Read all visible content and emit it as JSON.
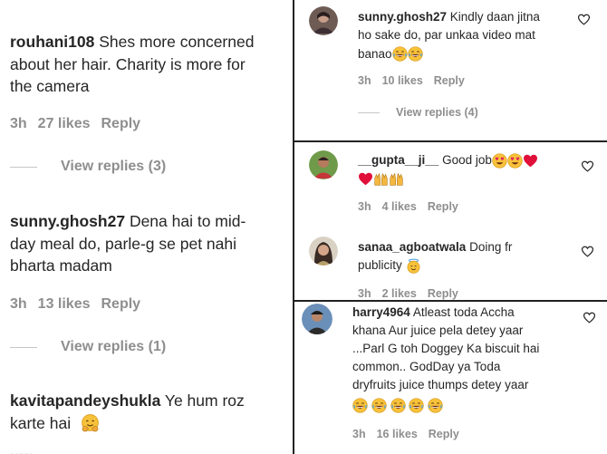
{
  "left": {
    "c1": {
      "user": "rouhani108",
      "text1": "Shes more concerned",
      "text2": "about her hair. Charity is more for",
      "text3": "the camera",
      "time": "3h",
      "likes": "27 likes",
      "reply": "Reply",
      "view": "View replies (3)"
    },
    "c2": {
      "user": "sunny.ghosh27",
      "text1": "Dena hai to mid-",
      "text2": "day meal do, parle-g se pet nahi",
      "text3": "bharta madam",
      "time": "3h",
      "likes": "13 likes",
      "reply": "Reply",
      "view": "View replies (1)"
    },
    "c3": {
      "user": "kavitapandeyshukla",
      "text1": "Ye hum roz",
      "text2": "karte hai"
    }
  },
  "right": {
    "a": {
      "user": "sunny.ghosh27",
      "text1": "Kindly daan jitna",
      "text2": "ho sake do, par unkaa video mat",
      "text3": "banao",
      "time": "3h",
      "likes": "10 likes",
      "reply": "Reply",
      "view": "View replies (4)"
    },
    "b1": {
      "user": "__gupta__ji__",
      "text1": "Good job",
      "time": "3h",
      "likes": "4 likes",
      "reply": "Reply"
    },
    "b2": {
      "user": "sanaa_agboatwala",
      "text1": "Doing fr",
      "text2": "publicity",
      "time": "3h",
      "likes": "2 likes",
      "reply": "Reply"
    },
    "c": {
      "user": "harry4964",
      "text1": "Atleast toda Accha",
      "text2": "khana Aur juice pela detey yaar",
      "text3": "...Parl G toh Doggey Ka biscuit hai",
      "text4": "common.. GodDay ya Toda",
      "text5": "dryfruits juice thumps detey yaar",
      "time": "3h",
      "likes": "16 likes",
      "reply": "Reply"
    }
  },
  "colors": {
    "text": "#262626",
    "meta": "#8e8e8e",
    "border": "#222222",
    "heart": "#262626"
  },
  "icons": [
    "heart-outline-icon",
    "grinning-sweat-emoji",
    "heart-eyes-emoji",
    "red-heart-emoji",
    "raised-hands-emoji",
    "hugging-emoji",
    "smiling-halo-emoji",
    "tears-of-joy-emoji"
  ]
}
